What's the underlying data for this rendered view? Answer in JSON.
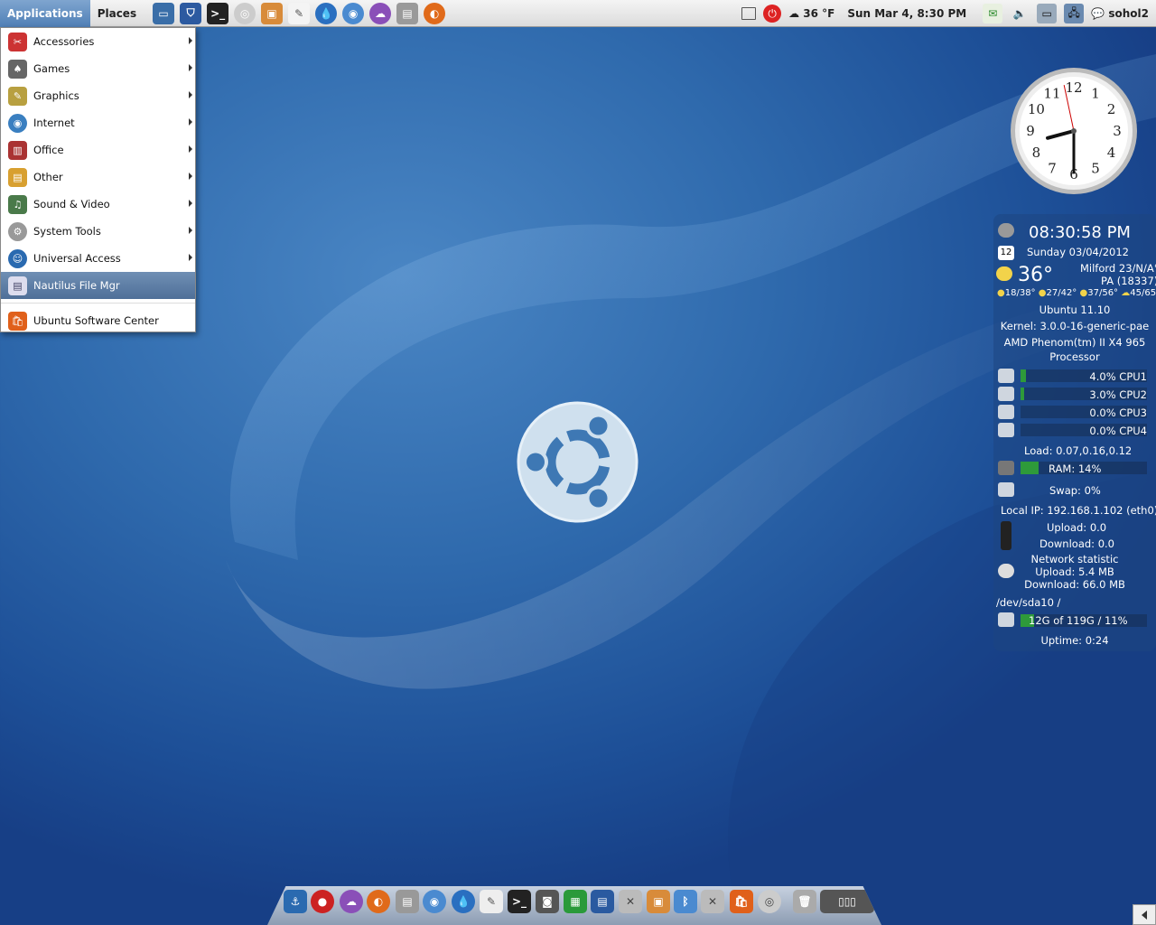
{
  "panel": {
    "applications_label": "Applications",
    "places_label": "Places",
    "weather": "36 °F",
    "datetime": "Sun Mar  4,  8:30 PM",
    "username": "sohol2"
  },
  "menu": {
    "items": [
      {
        "label": "Accessories",
        "icon": "accessories-icon",
        "submenu": true
      },
      {
        "label": "Games",
        "icon": "games-icon",
        "submenu": true
      },
      {
        "label": "Graphics",
        "icon": "graphics-icon",
        "submenu": true
      },
      {
        "label": "Internet",
        "icon": "internet-icon",
        "submenu": true
      },
      {
        "label": "Office",
        "icon": "office-icon",
        "submenu": true
      },
      {
        "label": "Other",
        "icon": "other-icon",
        "submenu": true
      },
      {
        "label": "Sound & Video",
        "icon": "sound-video-icon",
        "submenu": true
      },
      {
        "label": "System Tools",
        "icon": "system-tools-icon",
        "submenu": true
      },
      {
        "label": "Universal Access",
        "icon": "universal-access-icon",
        "submenu": true
      },
      {
        "label": "Nautilus File Mgr",
        "icon": "file-manager-icon",
        "submenu": false,
        "selected": true
      }
    ],
    "software_center": "Ubuntu Software Center"
  },
  "clock": {
    "numbers": [
      "12",
      "1",
      "2",
      "3",
      "4",
      "5",
      "6",
      "7",
      "8",
      "9",
      "10",
      "11"
    ],
    "hour": 8,
    "minute": 30,
    "second": 58
  },
  "sysmon": {
    "time": "08:30:58 PM",
    "date": "Sunday 03/04/2012",
    "calendar_day": "12",
    "temp": "36°",
    "location_line1": "Milford 23/N/A°",
    "location_line2": "PA (18337)",
    "forecast": [
      "18/38°",
      "27/42°",
      "37/56°",
      "45/65°"
    ],
    "os": "Ubuntu 11.10",
    "kernel": "Kernel: 3.0.0-16-generic-pae",
    "cpu_name_1": "AMD Phenom(tm) II X4 965",
    "cpu_name_2": "Processor",
    "cpus": [
      {
        "label": "4.0% CPU1",
        "fill": 0.04
      },
      {
        "label": "3.0% CPU2",
        "fill": 0.03
      },
      {
        "label": "0.0% CPU3",
        "fill": 0
      },
      {
        "label": "0.0% CPU4",
        "fill": 0
      }
    ],
    "load": "Load: 0.07,0.16,0.12",
    "ram": "RAM: 14%",
    "ram_fill": 0.14,
    "swap": "Swap: 0%",
    "local_ip": "Local IP: 192.168.1.102 (eth0)",
    "upload": "Upload: 0.0",
    "download": "Download: 0.0",
    "net_title": "Network statistic",
    "net_up": "Upload: 5.4 MB",
    "net_down": "Download: 66.0 MB",
    "disk_label": "/dev/sda10  /",
    "disk_usage": "12G of 119G / 11%",
    "disk_fill": 0.11,
    "uptime": "Uptime: 0:24"
  },
  "colors": {
    "accent": "#4f7fb6",
    "desktop": "#2f6aad",
    "cpu_bar": "#2e9a3a"
  }
}
